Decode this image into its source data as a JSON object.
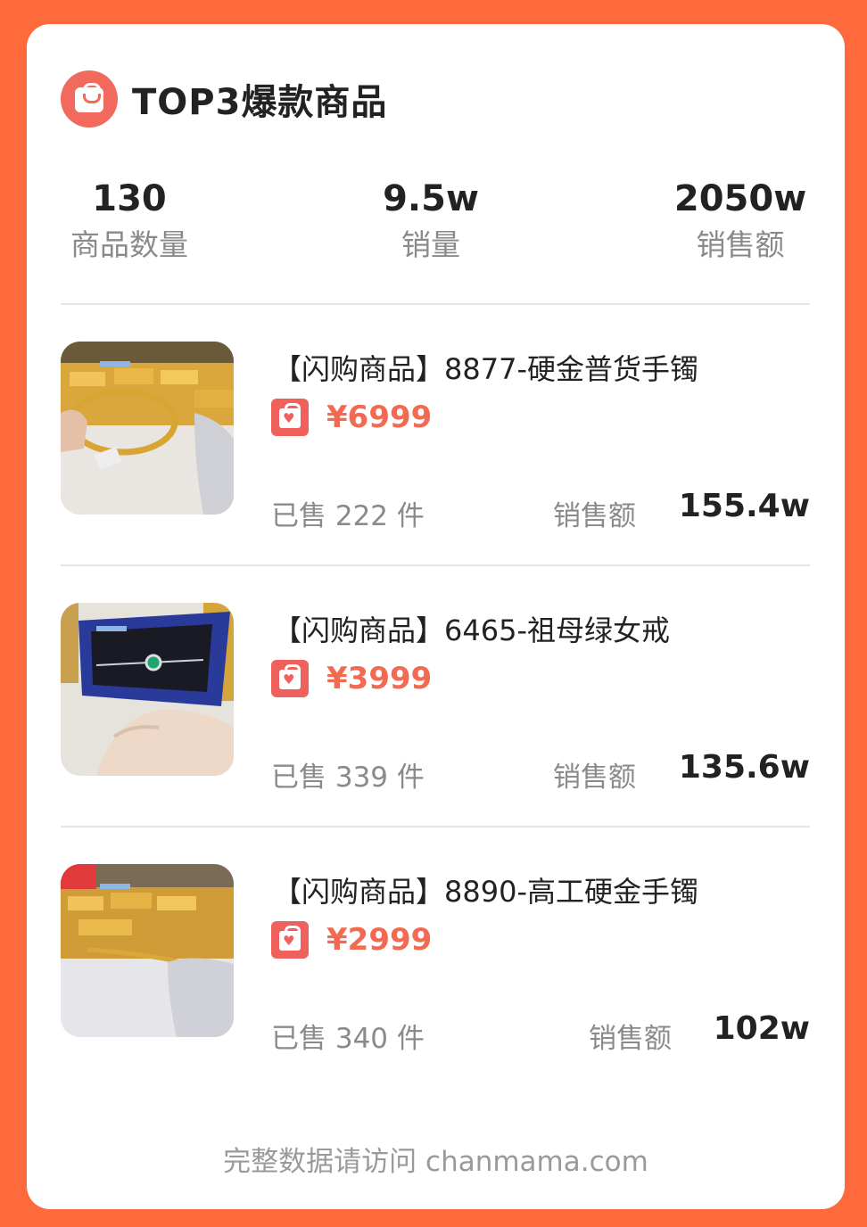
{
  "header": {
    "title": "TOP3爆款商品",
    "icon": "shopping-bag-icon"
  },
  "stats": [
    {
      "value": "130",
      "label": "商品数量"
    },
    {
      "value": "9.5w",
      "label": "销量"
    },
    {
      "value": "2050w",
      "label": "销售额"
    }
  ],
  "products": [
    {
      "name": "【闪购商品】8877-硬金普货手镯",
      "price": "¥6999",
      "sold": "已售 222 件",
      "sales_label": "销售额",
      "sales_value": "155.4w"
    },
    {
      "name": "【闪购商品】6465-祖母绿女戒",
      "price": "¥3999",
      "sold": "已售 339 件",
      "sales_label": "销售额",
      "sales_value": "135.6w"
    },
    {
      "name": "【闪购商品】8890-高工硬金手镯",
      "price": "¥2999",
      "sold": "已售 340 件",
      "sales_label": "销售额",
      "sales_value": "102w"
    }
  ],
  "footer": {
    "text": "完整数据请访问 chanmama.com"
  },
  "colors": {
    "background": "#ff6a3d",
    "accent": "#f36a52",
    "icon": "#f26a5e"
  }
}
